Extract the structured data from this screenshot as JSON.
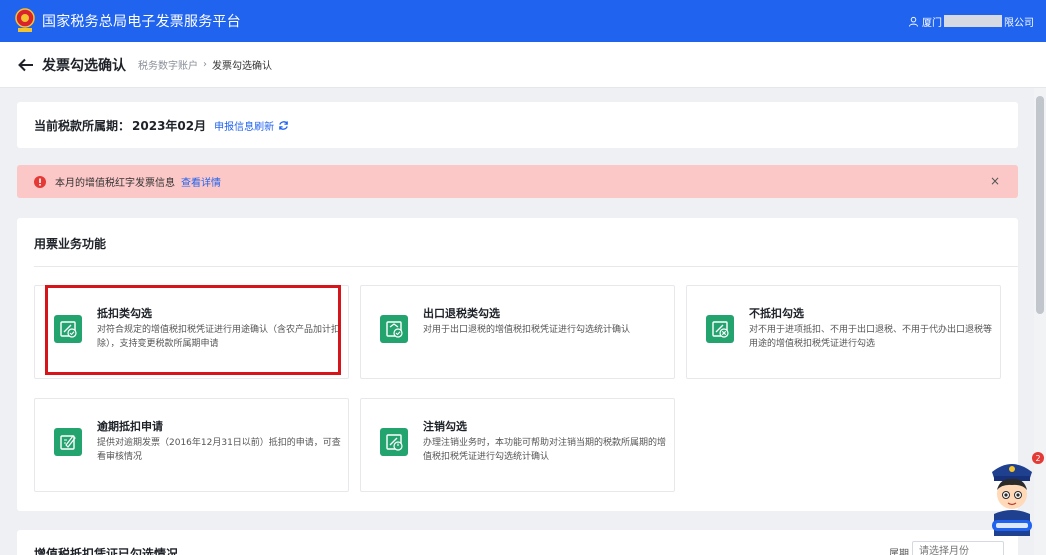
{
  "header": {
    "app_title": "国家税务总局电子发票服务平台",
    "user_prefix": "厦门",
    "user_suffix": "限公司"
  },
  "subheader": {
    "page_title": "发票勾选确认",
    "breadcrumb": [
      "税务数字账户",
      "发票勾选确认"
    ],
    "breadcrumb_sep": "›"
  },
  "period": {
    "label": "当前税款所属期：",
    "value": "2023年02月",
    "refresh_label": "申报信息刷新"
  },
  "alert": {
    "text": "本月的增值税红字发票信息",
    "link": "查看详情",
    "close": "×"
  },
  "functions": {
    "section_title": "用票业务功能",
    "tiles": [
      {
        "name": "抵扣类勾选",
        "desc": "对符合规定的增值税扣税凭证进行用途确认（含农产品加计扣除），支持变更税款所属期申请"
      },
      {
        "name": "出口退税类勾选",
        "desc": "对用于出口退税的增值税扣税凭证进行勾选统计确认"
      },
      {
        "name": "不抵扣勾选",
        "desc": "对不用于进项抵扣、不用于出口退税、不用于代办出口退税等用途的增值税扣税凭证进行勾选"
      },
      {
        "name": "逾期抵扣申请",
        "desc": "提供对逾期发票（2016年12月31日以前）抵扣的申请，可查看审核情况"
      },
      {
        "name": "注销勾选",
        "desc": "办理注销业务时，本功能可帮助对注销当期的税款所属期的增值税扣税凭证进行勾选统计确认"
      }
    ]
  },
  "bottom": {
    "title": "增值税抵扣凭证已勾选情况",
    "period_label": "属期",
    "period_placeholder": "请选择月份"
  },
  "mascot": {
    "badge": "2"
  },
  "colors": {
    "primary": "#1f63ef",
    "tile_icon": "#23a46f",
    "alert_bg": "#fcc7c7",
    "highlight": "#d7141a"
  }
}
